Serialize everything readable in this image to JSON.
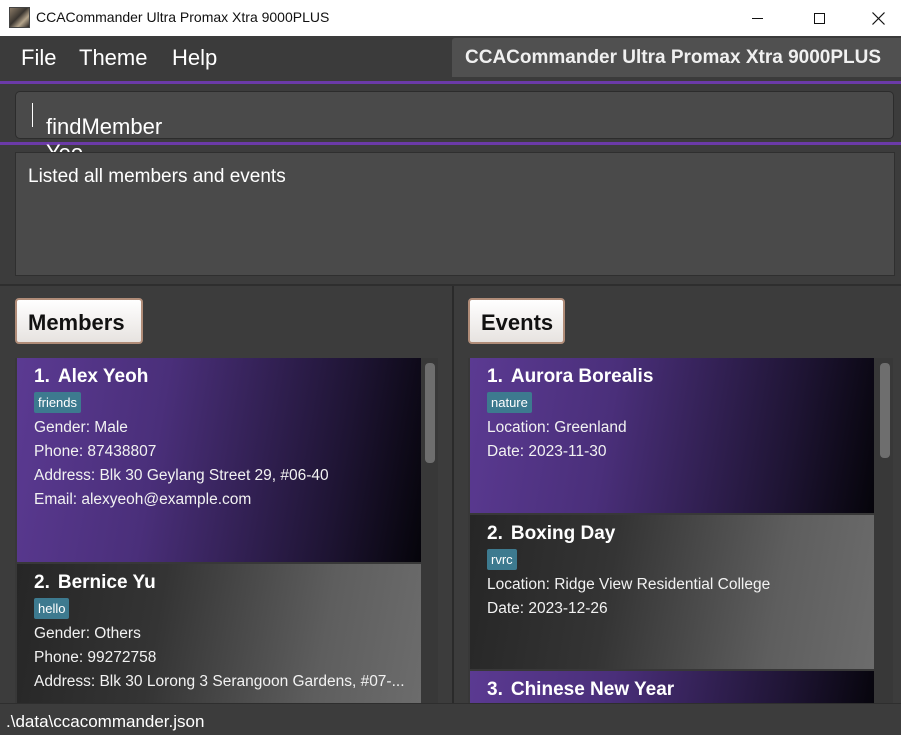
{
  "window": {
    "title": "CCACommander Ultra Promax Xtra 9000PLUS",
    "minimize_label": "",
    "maximize_label": "",
    "close_label": "✕"
  },
  "menu": {
    "file": "File",
    "theme": "Theme",
    "help": "Help"
  },
  "app_banner": "CCACommander Ultra Promax Xtra 9000PLUS",
  "command": {
    "value": "findMember Yeo"
  },
  "result": "Listed all members and events",
  "members": {
    "title": "Members",
    "items": [
      {
        "index": "1.",
        "name": "Alex Yeoh",
        "tag": "friends",
        "gender": "Gender: Male",
        "phone": "Phone: 87438807",
        "address": "Address: Blk 30 Geylang Street 29, #06-40",
        "email": "Email: alexyeoh@example.com"
      },
      {
        "index": "2.",
        "name": "Bernice Yu",
        "tag": "hello",
        "gender": "Gender: Others",
        "phone": "Phone: 99272758",
        "address": "Address: Blk 30 Lorong 3 Serangoon Gardens, #07-..."
      }
    ]
  },
  "events": {
    "title": "Events",
    "items": [
      {
        "index": "1.",
        "name": "Aurora Borealis",
        "tag": "nature",
        "location": "Location: Greenland",
        "date": "Date: 2023-11-30"
      },
      {
        "index": "2.",
        "name": "Boxing Day",
        "tag": "rvrc",
        "location": "Location: Ridge View Residential College",
        "date": "Date: 2023-12-26"
      },
      {
        "index": "3.",
        "name": "Chinese New Year"
      }
    ]
  },
  "status": ".\\data\\ccacommander.json",
  "colors": {
    "accent": "#6b3aa8",
    "tag": "#3d7a8f",
    "background": "#3c3c3c"
  }
}
